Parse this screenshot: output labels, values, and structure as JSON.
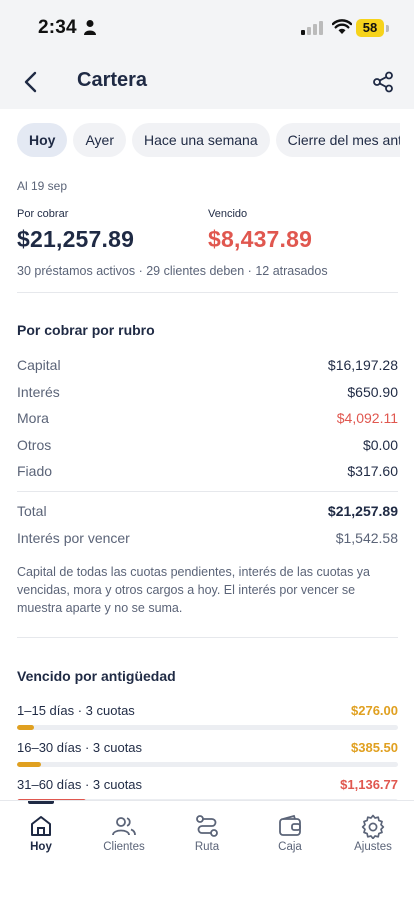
{
  "status": {
    "time": "2:34",
    "battery": "58"
  },
  "header": {
    "title": "Cartera",
    "back_icon": "chevron-left-icon",
    "share_icon": "share-icon"
  },
  "chips": [
    {
      "label": "Hoy",
      "active": true
    },
    {
      "label": "Ayer",
      "active": false
    },
    {
      "label": "Hace una semana",
      "active": false
    },
    {
      "label": "Cierre del mes anterior",
      "active": false
    }
  ],
  "summary": {
    "date": "Al 19 sep",
    "por_cobrar_label": "Por cobrar",
    "por_cobrar_value": "$21,257.89",
    "vencido_label": "Vencido",
    "vencido_value": "$8,437.89",
    "line": "30 préstamos activos · 29 clientes deben · 12 atrasados"
  },
  "rubro": {
    "title": "Por cobrar por rubro",
    "rows": [
      {
        "label": "Capital",
        "value": "$16,197.28"
      },
      {
        "label": "Interés",
        "value": "$650.90"
      },
      {
        "label": "Mora",
        "value": "$4,092.11"
      },
      {
        "label": "Otros",
        "value": "$0.00"
      },
      {
        "label": "Fiado",
        "value": "$317.60"
      }
    ],
    "total_label": "Total",
    "total_value": "$21,257.89",
    "interes_vencer_label": "Interés por vencer",
    "interes_vencer_value": "$1,542.58",
    "note": "Capital de todas las cuotas pendientes, interés de las cuotas ya vencidas, mora y otros cargos a hoy. El interés por vencer se muestra aparte y no se suma."
  },
  "aging": {
    "title": "Vencido por antigüedad",
    "rows": [
      {
        "label": "1–15 días · 3 cuotas",
        "value": "$276.00",
        "fraction": 0.044,
        "color": "#e0a020"
      },
      {
        "label": "16–30 días · 3 cuotas",
        "value": "$385.50",
        "fraction": 0.062,
        "color": "#e0a020"
      },
      {
        "label": "31–60 días · 3 cuotas",
        "value": "$1,136.77",
        "fraction": 0.182,
        "color": "#e0574f"
      }
    ]
  },
  "nav": [
    {
      "label": "Hoy",
      "icon": "home-icon",
      "active": true
    },
    {
      "label": "Clientes",
      "icon": "users-icon",
      "active": false
    },
    {
      "label": "Ruta",
      "icon": "route-icon",
      "active": false
    },
    {
      "label": "Caja",
      "icon": "wallet-icon",
      "active": false
    },
    {
      "label": "Ajustes",
      "icon": "gear-icon",
      "active": false
    }
  ],
  "colors": {
    "primary": "#1f2a44",
    "danger": "#e0574f",
    "warning": "#e0a020",
    "muted": "#5b6478"
  }
}
